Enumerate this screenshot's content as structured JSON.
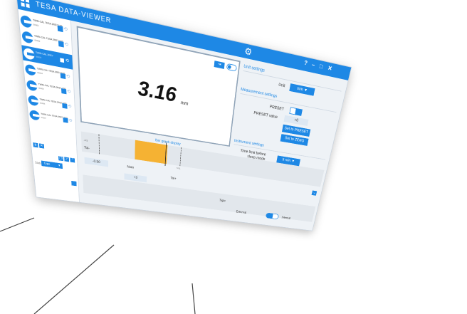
{
  "app": {
    "title": "TESA DATA-VIEWER"
  },
  "window_buttons": [
    "?",
    "–",
    "□",
    "✕"
  ],
  "instruments": [
    {
      "name": "TWIN-CAL TESA 2RE7 100",
      "serial": "00001",
      "selected": false
    },
    {
      "name": "TWIN-CAL TESA 2RE7 100",
      "serial": "00002",
      "selected": false
    },
    {
      "name": "TWIN-CAL 2RE7",
      "serial": "00003",
      "selected": true
    },
    {
      "name": "TWIN-CAL TESA 2RE7 100",
      "serial": "00004",
      "selected": false
    },
    {
      "name": "TWIN-CAL TESA 2RE7 100",
      "serial": "00005",
      "selected": false
    },
    {
      "name": "TWIN-CAL TESA 2RE7 100",
      "serial": "00006",
      "selected": false
    },
    {
      "name": "TWIN-CAL TESA 2RE7 100",
      "serial": "00007",
      "selected": false
    }
  ],
  "sidebar": {
    "status_label": "Status",
    "status_value": "Type"
  },
  "display": {
    "reading": "3.16",
    "unit": "mm"
  },
  "unit_settings": {
    "title": "Unit settings",
    "unit_label": "Unit",
    "unit_value": "mm"
  },
  "measurement_settings": {
    "title": "Measurement settings",
    "preset_label": "PRESET",
    "preset_value_label": "PRESET value",
    "preset_value": "+0",
    "set_to_preset": "Set to PRESET",
    "set_to_zero": "Set to ZERO"
  },
  "instrument_settings": {
    "title": "Instrument settings",
    "time_limit_label": "Time limit before sleep mode",
    "time_limit_value": "5 min"
  },
  "bar_graph": {
    "title": "Bar graph display",
    "min_label": "-0.5",
    "max_label": "+0.1",
    "center_label": "0",
    "fill_start": 0.4,
    "fill_end": 0.65,
    "tol_minus_label": "Tol-",
    "tol_minus_value": "-0.50",
    "nom_label": "Nom",
    "nom_value": "+3",
    "tol_plus_label": "Tol+",
    "tol_plus_value": "+0.10",
    "type_label": "Type",
    "external_label": "External",
    "internal_label": "Internal"
  }
}
